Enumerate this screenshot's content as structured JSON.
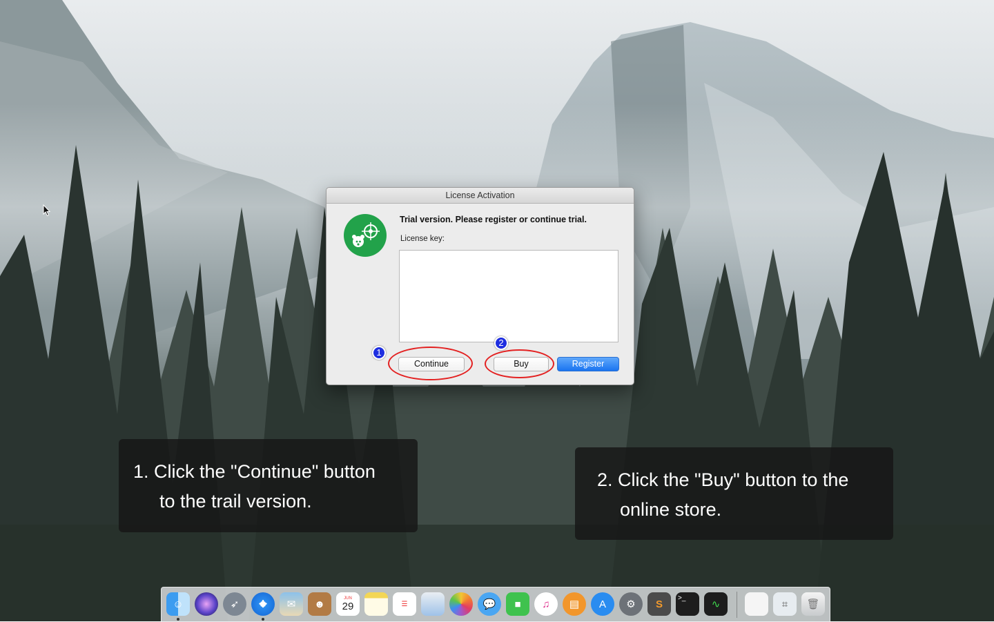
{
  "dialog": {
    "title": "License Activation",
    "heading": "Trial version. Please register or continue trial.",
    "key_label": "License key:",
    "key_value": "",
    "continue_label": "Continue",
    "buy_label": "Buy",
    "register_label": "Register"
  },
  "annotations": {
    "badge1": "1",
    "badge2": "2",
    "caption1_line1": "1. Click the \"Continue\" button",
    "caption1_line2": "to the trail version.",
    "caption2_line1": "2. Click the \"Buy\" button to the",
    "caption2_line2": "online store."
  },
  "dock": {
    "calendar_month": "JUN",
    "calendar_day": "29",
    "items": [
      "finder-icon",
      "siri-icon",
      "launchpad-icon",
      "safari-icon",
      "mail-icon",
      "contacts-icon",
      "calendar-icon",
      "notes-icon",
      "reminders-icon",
      "preview-icon",
      "photos-icon",
      "messages-icon",
      "facetime-icon",
      "itunes-icon",
      "ibooks-icon",
      "app-store-icon",
      "system-preferences-icon",
      "sublime-text-icon",
      "terminal-icon",
      "activity-monitor-icon",
      "document-stack-icon",
      "screenshot-icon",
      "trash-icon"
    ]
  },
  "colors": {
    "accent_blue": "#1a74f0",
    "annotation_red": "#e32020",
    "badge_blue": "#1e2ee0",
    "app_icon_green": "#22a24a"
  }
}
